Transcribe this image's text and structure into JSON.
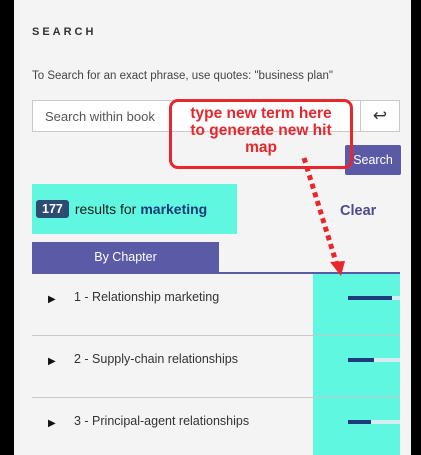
{
  "search": {
    "heading": "SEARCH",
    "hint": "To Search for an exact phrase, use quotes: \"business plan\"",
    "placeholder": "Search within book",
    "enter_icon": "return-arrow-icon",
    "button_label": "Search"
  },
  "annotation": {
    "lines": [
      "type new term here",
      "to generate new hit",
      "map"
    ],
    "color": "#e8262c"
  },
  "results": {
    "count": "177",
    "text": "results for",
    "term": "marketing",
    "clear_label": "Clear"
  },
  "tabs": [
    {
      "label": "By Chapter"
    }
  ],
  "chapters": [
    {
      "label": "1 - Relationship marketing",
      "hit_level": 0.85
    },
    {
      "label": "2 - Supply-chain relationships",
      "hit_level": 0.5
    },
    {
      "label": "3 - Principal-agent relationships",
      "hit_level": 0.45
    }
  ],
  "colors": {
    "accent": "#5a5aa6",
    "highlight": "#5ff7e0",
    "badge": "#2c4c74",
    "hit_bar": "#1e3c7a"
  }
}
